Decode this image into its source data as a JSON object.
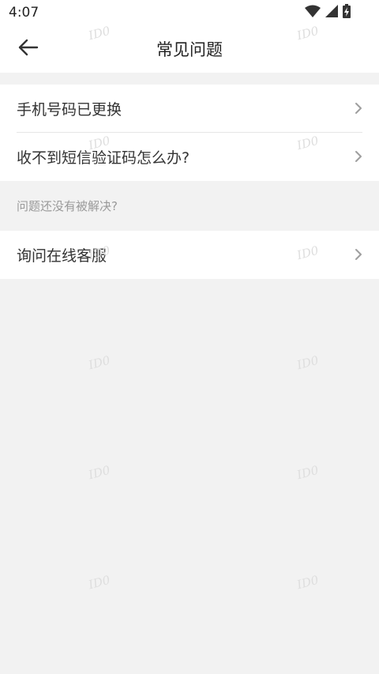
{
  "status_bar": {
    "time": "4:07",
    "icons": [
      "wifi-icon",
      "cellular-signal-icon",
      "battery-charging-icon"
    ]
  },
  "header": {
    "title": "常见问题",
    "back_icon": "arrow-left-icon"
  },
  "faq_items": [
    {
      "label": "手机号码已更换"
    },
    {
      "label": "收不到短信验证码怎么办?"
    }
  ],
  "help_section": {
    "hint": "问题还没有被解决?",
    "items": [
      {
        "label": "询问在线客服"
      }
    ]
  },
  "watermark_text": "ID0",
  "colors": {
    "background": "#f2f2f2",
    "surface": "#ffffff",
    "text_primary": "#333333",
    "text_secondary": "#999999",
    "chevron": "#9e9e9e"
  }
}
